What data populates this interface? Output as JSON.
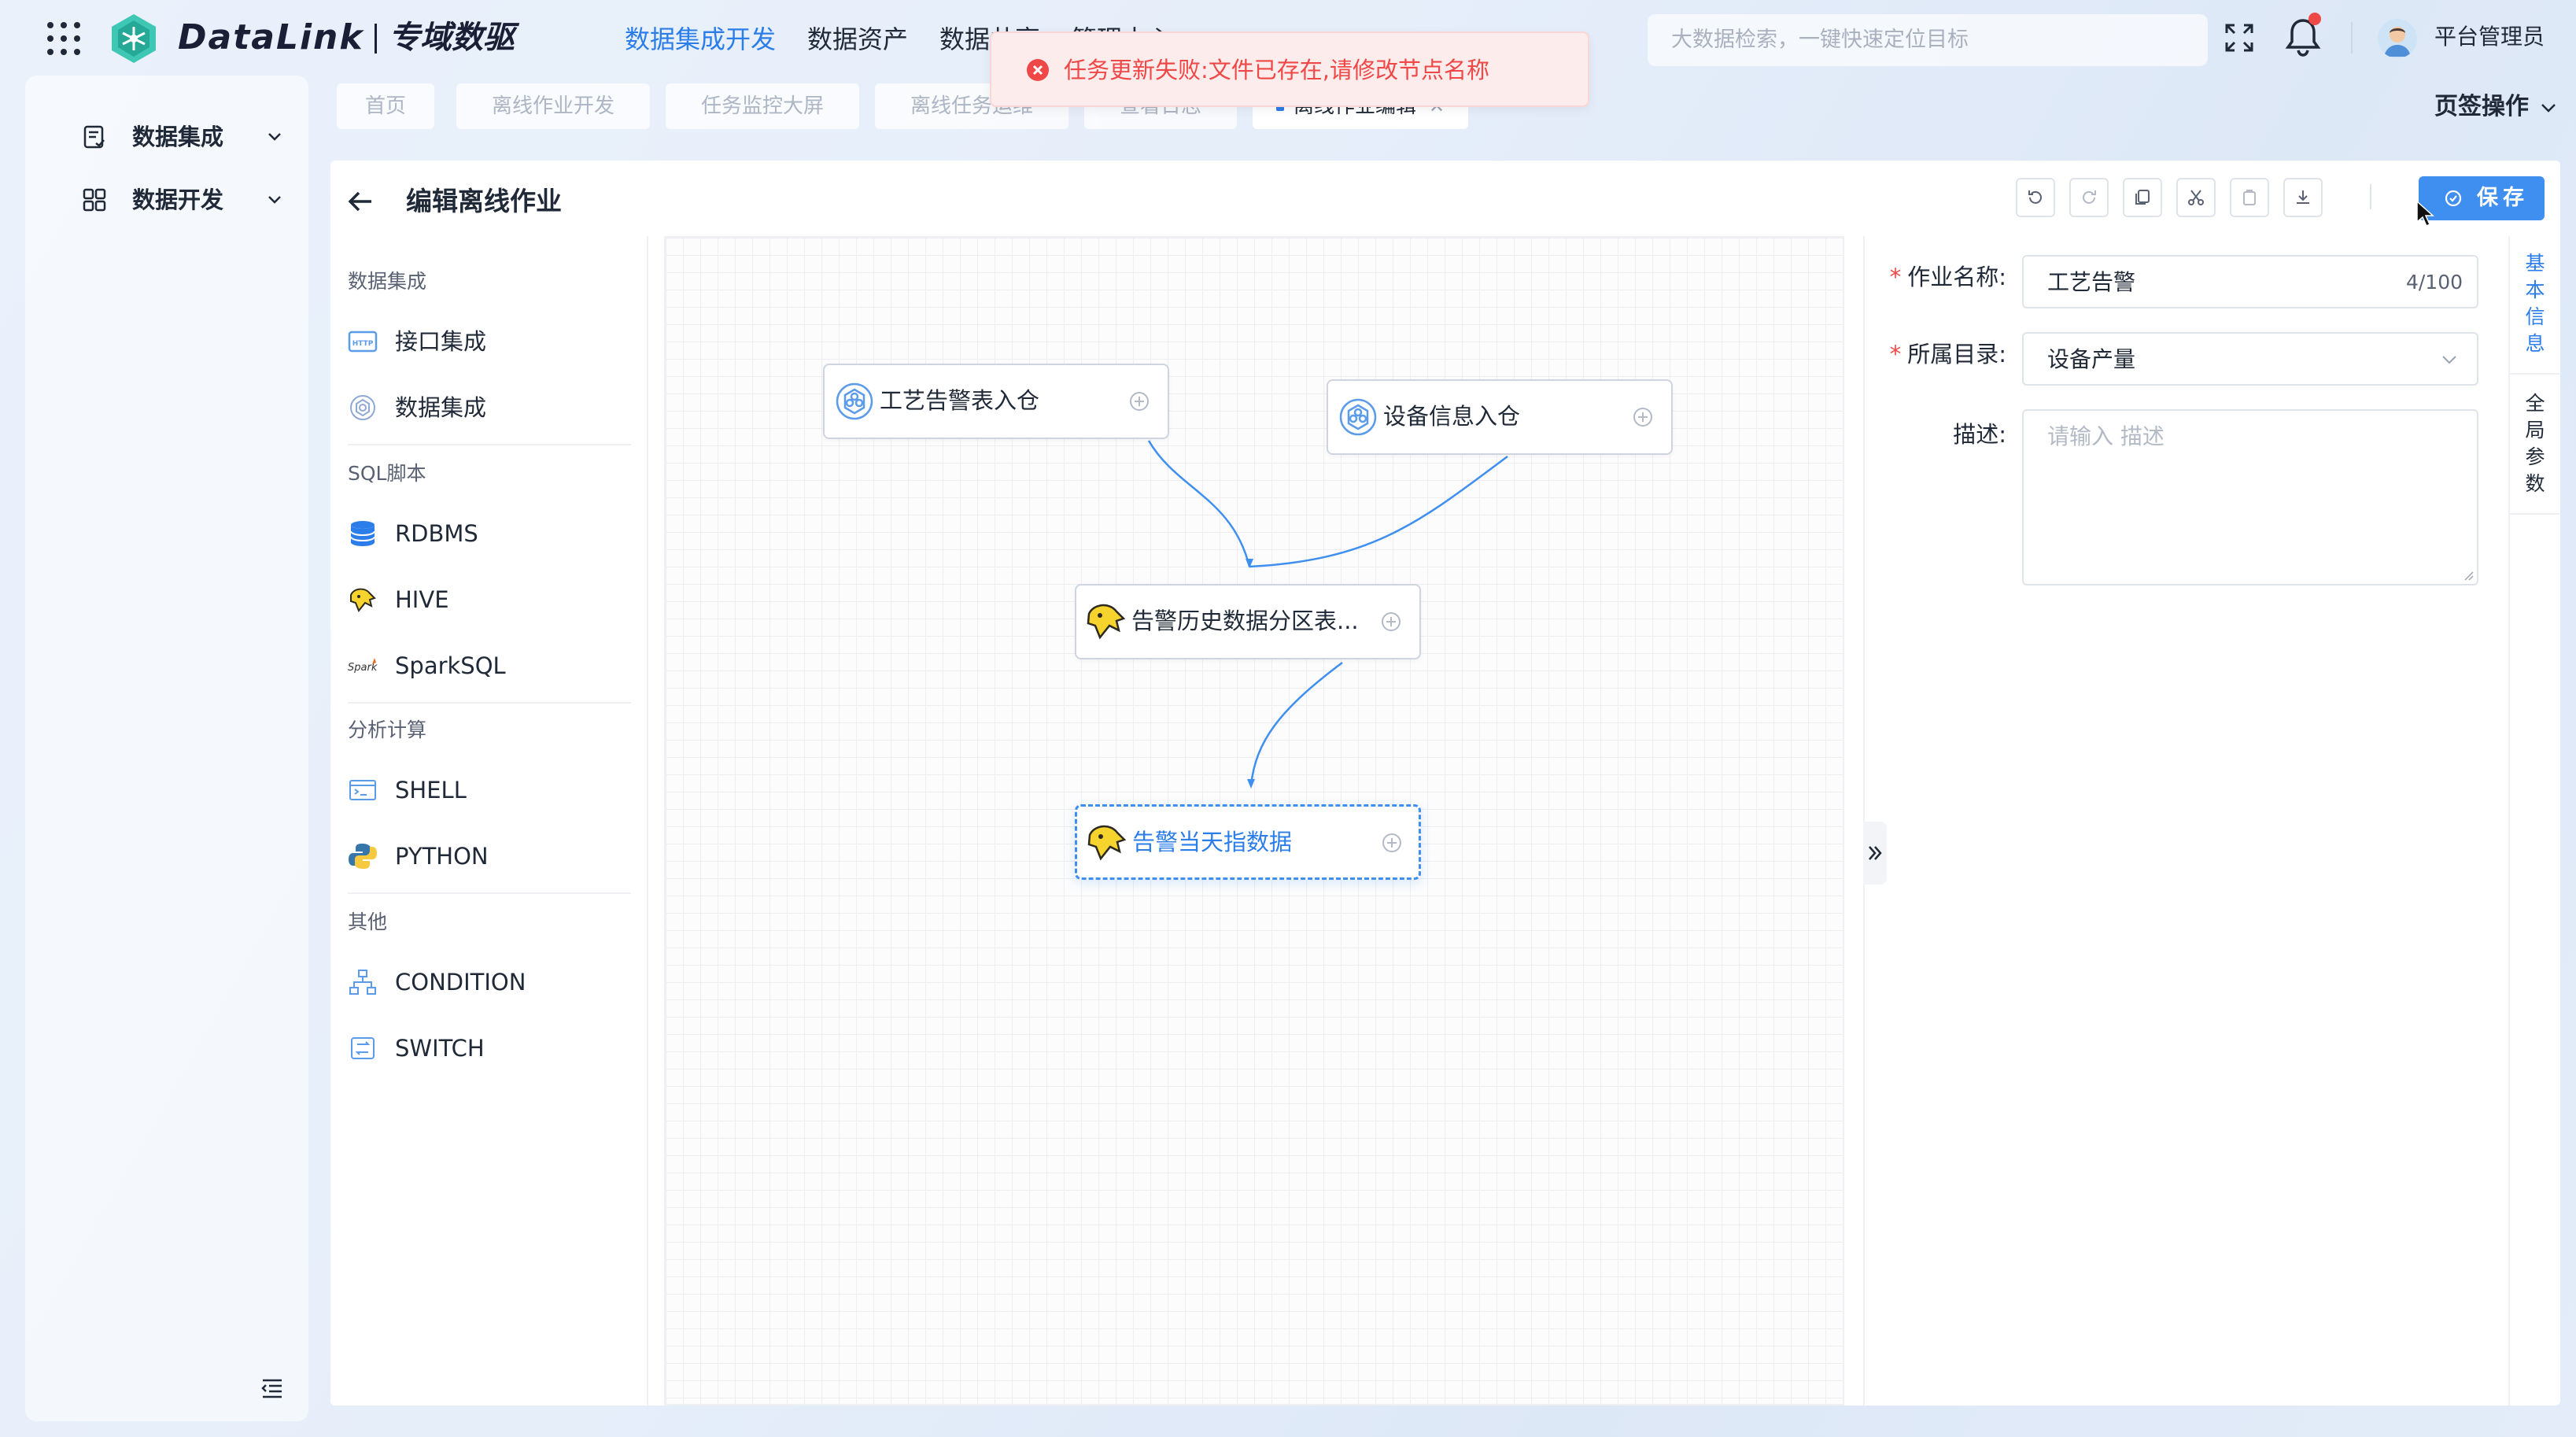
{
  "brand": {
    "name": "DataLink",
    "sub": "专域数驱"
  },
  "nav": {
    "items": [
      "数据集成开发",
      "数据资产",
      "数据共享",
      "管理中心"
    ]
  },
  "search": {
    "placeholder": "大数据检索，一键快速定位目标"
  },
  "user": {
    "name": "平台管理员"
  },
  "sidebar": {
    "items": [
      {
        "label": "数据集成",
        "icon": "document-list-icon"
      },
      {
        "label": "数据开发",
        "icon": "grid-apps-icon"
      }
    ]
  },
  "tabs": [
    "首页",
    "离线作业开发",
    "任务监控大屏",
    "离线任务运维",
    "查看日志",
    "离线作业编辑"
  ],
  "page_ops": "页签操作",
  "toast": {
    "message": "任务更新失败:文件已存在,请修改节点名称",
    "color": "#f04747"
  },
  "editor": {
    "title": "编辑离线作业",
    "save_label": "保存",
    "palette": {
      "groups": [
        {
          "title": "数据集成",
          "items": [
            "接口集成",
            "数据集成"
          ]
        },
        {
          "title": "SQL脚本",
          "items": [
            "RDBMS",
            "HIVE",
            "SparkSQL"
          ]
        },
        {
          "title": "分析计算",
          "items": [
            "SHELL",
            "PYTHON"
          ]
        },
        {
          "title": "其他",
          "items": [
            "CONDITION",
            "SWITCH"
          ]
        }
      ]
    },
    "nodes": [
      {
        "label": "工艺告警表入仓",
        "type": "数据集成"
      },
      {
        "label": "设备信息入仓",
        "type": "数据集成"
      },
      {
        "label": "告警历史数据分区表...",
        "type": "HIVE"
      },
      {
        "label": "告警当天指数据",
        "type": "HIVE",
        "selected": true
      }
    ],
    "form": {
      "name_label": "作业名称:",
      "name_value": "工艺告警",
      "name_count": "4/100",
      "dir_label": "所属目录:",
      "dir_value": "设备产量",
      "desc_label": "描述:",
      "desc_placeholder": "请输入 描述"
    },
    "side_tabs": [
      "基本信息",
      "全局参数"
    ]
  },
  "colors": {
    "accent": "#2b7de9",
    "error": "#f04747",
    "hive_yellow": "#f6d32d"
  }
}
